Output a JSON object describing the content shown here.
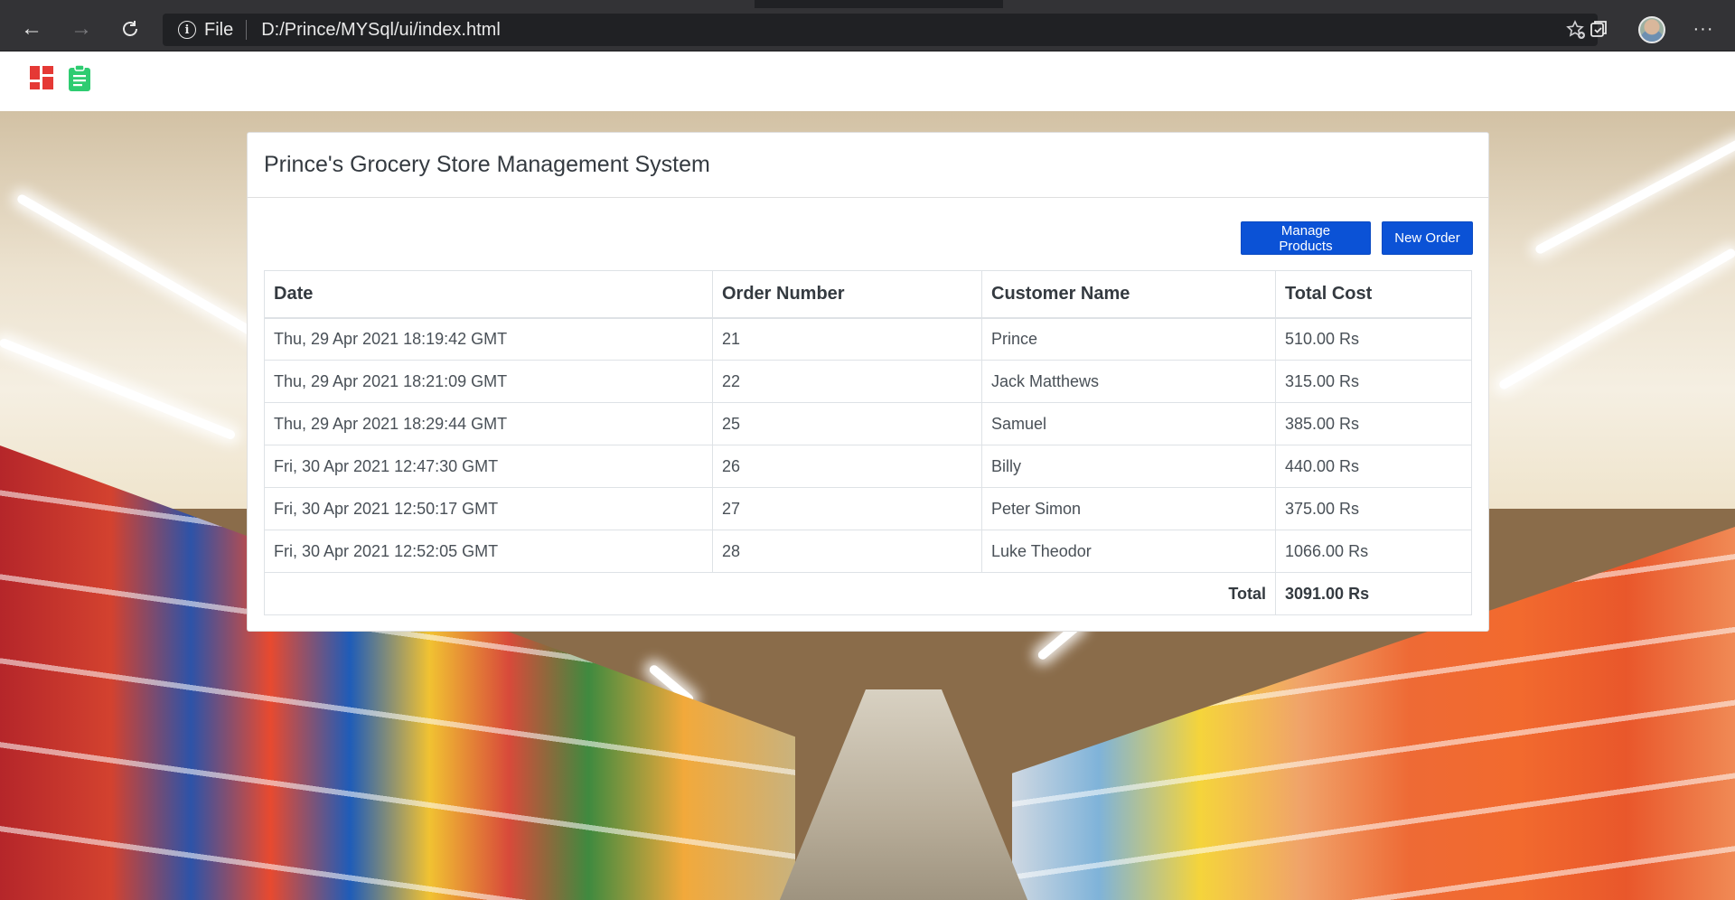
{
  "browser": {
    "scheme_label": "File",
    "url": "D:/Prince/MYSql/ui/index.html"
  },
  "page": {
    "title": "Prince's Grocery Store Management System",
    "buttons": {
      "manage_products": "Manage Products",
      "new_order": "New Order"
    },
    "table": {
      "headers": [
        "Date",
        "Order Number",
        "Customer Name",
        "Total Cost"
      ],
      "rows": [
        {
          "date": "Thu, 29 Apr 2021 18:19:42 GMT",
          "order_number": "21",
          "customer": "Prince",
          "total_cost": "510.00 Rs"
        },
        {
          "date": "Thu, 29 Apr 2021 18:21:09 GMT",
          "order_number": "22",
          "customer": "Jack Matthews",
          "total_cost": "315.00 Rs"
        },
        {
          "date": "Thu, 29 Apr 2021 18:29:44 GMT",
          "order_number": "25",
          "customer": "Samuel",
          "total_cost": "385.00 Rs"
        },
        {
          "date": "Fri, 30 Apr 2021 12:47:30 GMT",
          "order_number": "26",
          "customer": "Billy",
          "total_cost": "440.00 Rs"
        },
        {
          "date": "Fri, 30 Apr 2021 12:50:17 GMT",
          "order_number": "27",
          "customer": "Peter Simon",
          "total_cost": "375.00 Rs"
        },
        {
          "date": "Fri, 30 Apr 2021 12:52:05 GMT",
          "order_number": "28",
          "customer": "Luke Theodor",
          "total_cost": "1066.00 Rs"
        }
      ],
      "total_label": "Total",
      "total_value": "3091.00 Rs"
    }
  },
  "icons": {
    "back": "arrow-left-icon",
    "forward": "arrow-right-icon",
    "refresh": "refresh-icon",
    "info": "info-icon",
    "favorites": "star-add-icon",
    "collections": "collections-icon",
    "more": "more-icon",
    "dashboard": "dashboard-icon",
    "orders": "clipboard-icon"
  },
  "colors": {
    "primary_button": "#0b52d6",
    "dashboard_icon": "#e53935",
    "clipboard_icon": "#2ecc71",
    "browser_chrome": "#333336"
  }
}
